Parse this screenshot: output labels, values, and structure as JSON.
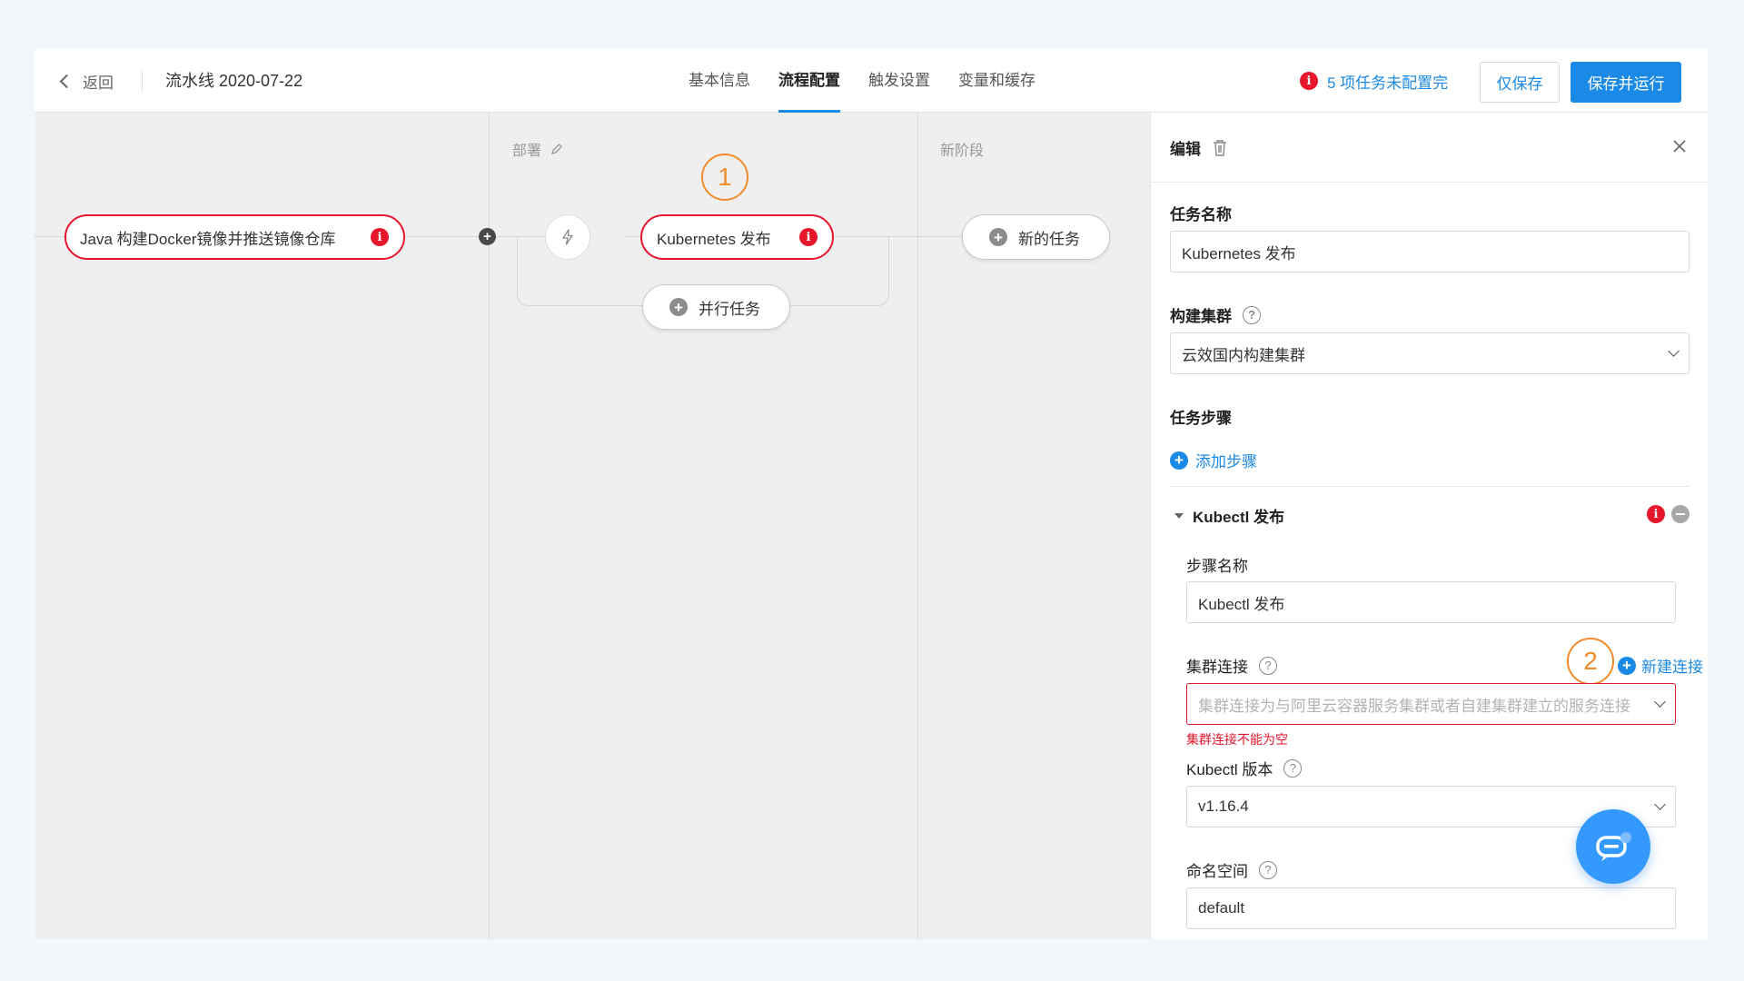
{
  "header": {
    "back_label": "返回",
    "pipeline_title": "流水线 2020-07-22",
    "tabs": [
      {
        "label": "基本信息"
      },
      {
        "label": "流程配置"
      },
      {
        "label": "触发设置"
      },
      {
        "label": "变量和缓存"
      }
    ],
    "warning_text": "5 项任务未配置完",
    "save_only_label": "仅保存",
    "save_run_label": "保存并运行"
  },
  "canvas": {
    "stage2_label": "部署",
    "stage3_label": "新阶段",
    "build_task": "Java 构建Docker镜像并推送镜像仓库",
    "deploy_task": "Kubernetes 发布",
    "parallel_task": "并行任务",
    "new_task": "新的任务",
    "badge1": "1"
  },
  "panel": {
    "title": "编辑",
    "task_name_label": "任务名称",
    "task_name_value": "Kubernetes 发布",
    "cluster_label": "构建集群",
    "cluster_value": "云效国内构建集群",
    "steps_label": "任务步骤",
    "add_step_label": "添加步骤",
    "step": {
      "title": "Kubectl 发布",
      "name_label": "步骤名称",
      "name_value": "Kubectl 发布",
      "conn_label": "集群连接",
      "new_conn_label": "新建连接",
      "conn_placeholder": "集群连接为与阿里云容器服务集群或者自建集群建立的服务连接",
      "conn_error": "集群连接不能为空",
      "version_label": "Kubectl 版本",
      "version_value": "v1.16.4",
      "namespace_label": "命名空间",
      "namespace_value": "default"
    },
    "badge2": "2"
  },
  "colors": {
    "accent": "#1b8ae6",
    "error": "#e6162d",
    "callout": "#f08c2a"
  }
}
